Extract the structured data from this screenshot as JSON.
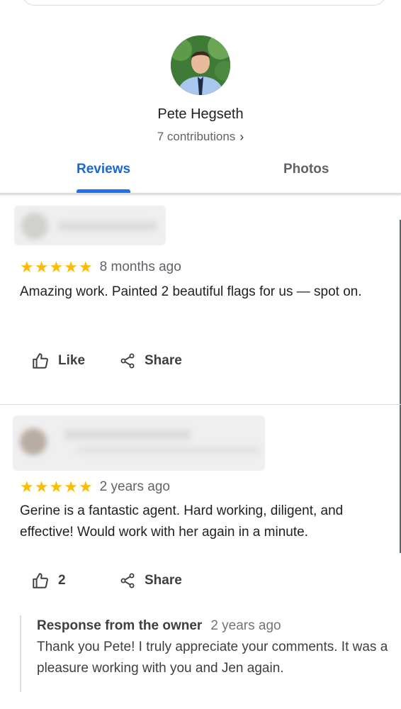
{
  "profile": {
    "name": "Pete Hegseth",
    "contributions": "7 contributions",
    "chevron_icon": "chevron-right-icon"
  },
  "tabs": [
    {
      "label": "Reviews",
      "active": true
    },
    {
      "label": "Photos",
      "active": false
    }
  ],
  "colors": {
    "accent": "#1a73e8",
    "star": "#fbbc04",
    "text_secondary": "#5f6368"
  },
  "reviews": [
    {
      "rating": 5,
      "time": "8 months ago",
      "text": "Amazing work. Painted 2 beautiful flags for us — spot on.",
      "like_label": "Like",
      "share_label": "Share"
    },
    {
      "rating": 5,
      "time": "2 years ago",
      "text": "Gerine is a fantastic agent. Hard working, diligent, and effective! Would work with her again in a minute.",
      "like_label": "2",
      "share_label": "Share",
      "owner_response": {
        "title": "Response from the owner",
        "time": "2 years ago",
        "text": "Thank you Pete! I truly appreciate your comments. It was a pleasure working with you and Jen again."
      }
    }
  ]
}
